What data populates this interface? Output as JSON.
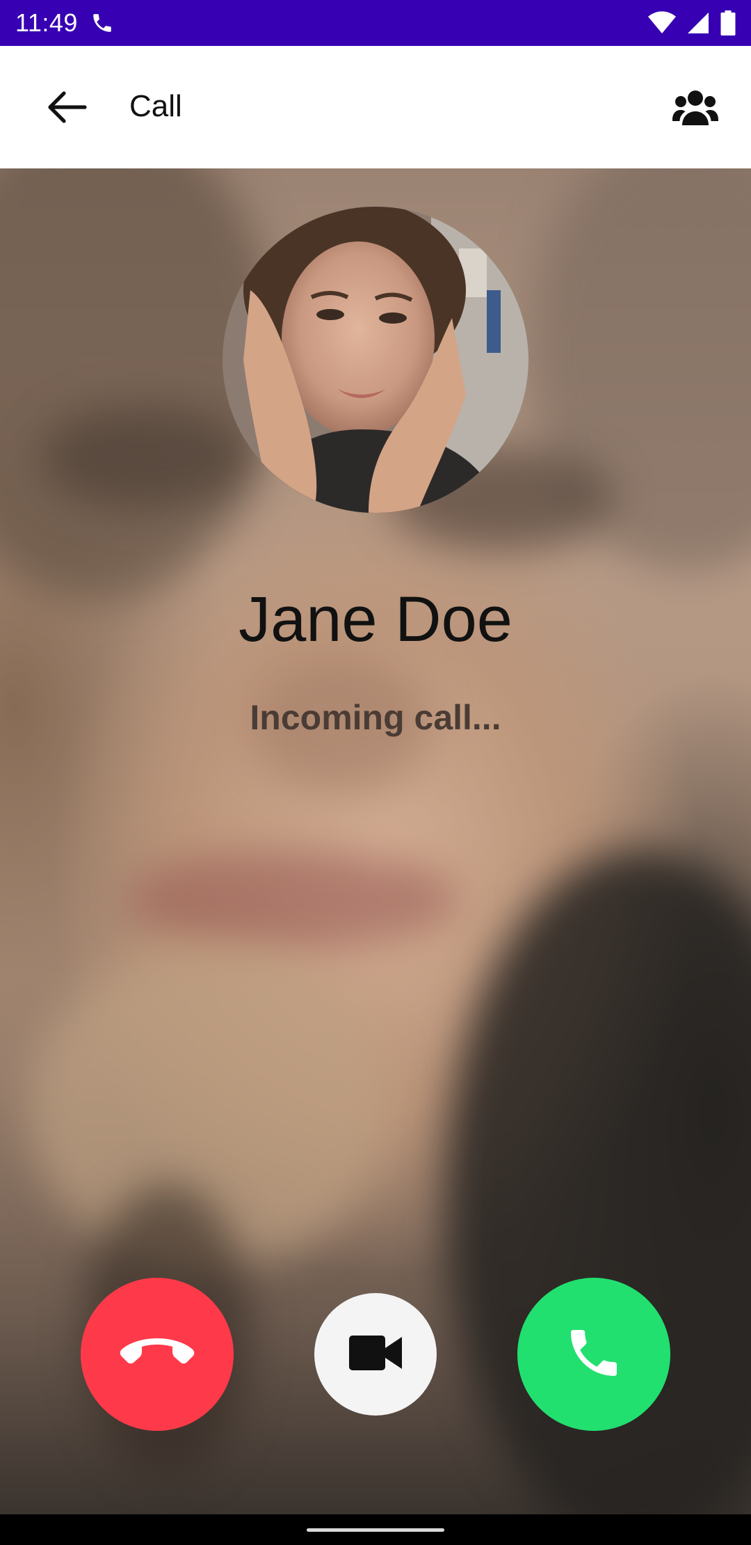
{
  "status_bar": {
    "time": "11:49",
    "icons": [
      "phone-icon",
      "wifi-icon",
      "signal-icon",
      "battery-icon"
    ],
    "background": "#3700b3"
  },
  "app_bar": {
    "title": "Call",
    "back_icon": "arrow-left-icon",
    "contacts_icon": "group-icon"
  },
  "caller": {
    "name": "Jane Doe",
    "status": "Incoming call..."
  },
  "actions": {
    "decline": {
      "icon": "call-end-icon",
      "color": "#fe3a4a"
    },
    "video": {
      "icon": "video-camera-icon",
      "color": "#f4f4f4"
    },
    "accept": {
      "icon": "phone-icon",
      "color": "#21e06f"
    }
  }
}
